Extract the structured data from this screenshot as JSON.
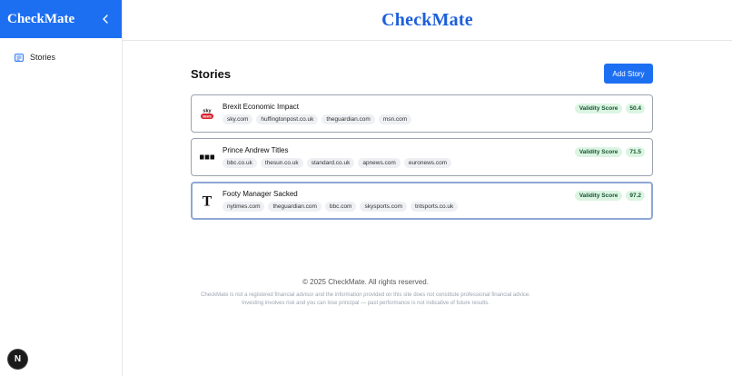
{
  "sidebar": {
    "brand": "CheckMate",
    "items": [
      {
        "label": "Stories",
        "icon": "stories-icon"
      }
    ]
  },
  "header": {
    "brand": "CheckMate"
  },
  "main": {
    "title": "Stories",
    "add_button": "Add Story",
    "score_label": "Validity Score",
    "stories": [
      {
        "title": "Brexit Economic Impact",
        "logo": "sky-news-logo",
        "score": "50.4",
        "sources": [
          "sky.com",
          "huffingtonpost.co.uk",
          "theguardian.com",
          "msn.com"
        ]
      },
      {
        "title": "Prince Andrew Titles",
        "logo": "bbc-logo",
        "score": "71.5",
        "sources": [
          "bbc.co.uk",
          "thesun.co.uk",
          "standard.co.uk",
          "apnews.com",
          "euronews.com"
        ]
      },
      {
        "title": "Footy Manager Sacked",
        "logo": "nytimes-logo",
        "score": "97.2",
        "sources": [
          "nytimes.com",
          "theguardian.com",
          "bbc.com",
          "skysports.com",
          "tntsports.co.uk"
        ]
      }
    ]
  },
  "footer": {
    "copyright": "© 2025 CheckMate. All rights reserved.",
    "disclaimer_line1": "CheckMate is not a registered financial advisor and the information provided on this site does not constitute professional financial advice.",
    "disclaimer_line2": "Investing involves risk and you can lose principal — past performance is not indicative of future results."
  },
  "badge": {
    "label": "N"
  },
  "colors": {
    "primary": "#1d6ff2",
    "brand_text": "#1d5fd9",
    "score_bg": "#dcf5e3",
    "score_text": "#14532d"
  }
}
